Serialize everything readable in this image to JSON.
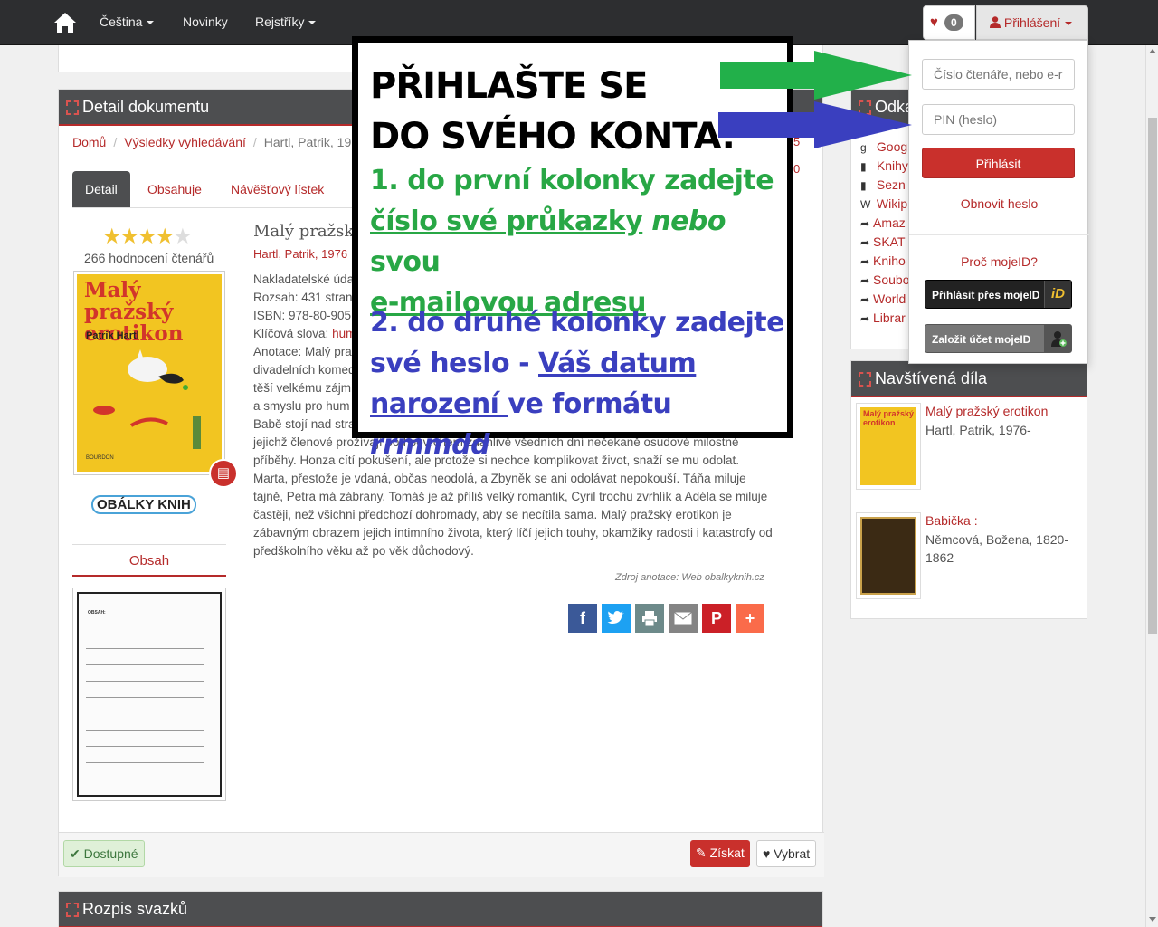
{
  "nav": {
    "language": "Čeština",
    "news": "Novinky",
    "registers": "Rejstříky",
    "favorites_count": "0",
    "login": "Přihlášení"
  },
  "detail_panel": {
    "title": "Detail dokumentu",
    "breadcrumb": [
      "Domů",
      "Výsledky vyhledávání",
      "Hartl, Patrik, 19"
    ],
    "tabs": [
      "Detail",
      "Obsahuje",
      "Návěšťový lístek"
    ],
    "rating": {
      "stars": 4,
      "max": 5,
      "count_text": "266 hodnocení čtenářů"
    },
    "cover": {
      "title": "Malý pražský erotikon",
      "author": "Patrik Hartl",
      "publisher": "BOURDON"
    },
    "obalky_logo": "OBÁLKY KNIH",
    "obsah_tab": "Obsah",
    "doc_title": "Malý pražský",
    "doc_author": "Hartl, Patrik, 1976",
    "lines": [
      "Nakladatelské úda",
      "Rozsah: 431 stran",
      "ISBN: 978-80-905",
      "Anotace: Malý pra",
      "divadelních komed",
      "těší velkému zájm",
      "a smyslu pro hum",
      "Babě stojí nad stra"
    ],
    "keywords_label": "Klíčová slova:",
    "keywords_value": "hum",
    "annotation_rest": "jejichž členové prožívají pod povrchem zdánlivě všedních dní nečekaně osudové milostné příběhy. Honza cítí pokušení, ale protože si nechce komplikovat život, snaží se mu odolat. Marta, přestože je vdaná, občas neodolá, a Zbyněk se ani odolávat nepokouší. Táňa miluje tajně, Petra má zábrany, Tomáš je až příliš velký romantik, Cyril trochu zvrhlík a Adéla se miluje častěji, než všichni předchozí dohromady, aby se necítila sama. Malý pražský erotikon je zábavným obrazem jejich intimního života, který líčí jejich touhy, okamžiky radosti i katastrofy od předškolního věku až po věk důchodový.",
    "source": "Zdroj anotace: Web obalkyknih.cz",
    "available": "Dostupné",
    "get": "Získat",
    "select": "Vybrat",
    "cut_digits": [
      "5",
      "0"
    ]
  },
  "volumes_panel": {
    "title": "Rozpis svazků"
  },
  "links_panel": {
    "title": "Odka",
    "items": [
      "Goog",
      "Knihy",
      "Sezn",
      "Wikip",
      "Amaz",
      "SKAT",
      "Kniho",
      "Soubo",
      "World",
      "Librar"
    ]
  },
  "visited_panel": {
    "title": "Navštívená díla",
    "items": [
      {
        "title": "Malý pražský erotikon",
        "author": "Hartl, Patrik, 1976-"
      },
      {
        "title": "Babička :",
        "author": "Němcová, Božena, 1820-1862"
      }
    ]
  },
  "login_dropdown": {
    "reader_placeholder": "Číslo čtenáře, nebo e-r",
    "pin_placeholder": "PIN (heslo)",
    "submit": "Přihlásit",
    "reset": "Obnovit heslo",
    "why_mojeid": "Proč mojeID?",
    "login_mojeid": "Přihlásit přes mojeID",
    "create_mojeid": "Založit účet mojeID"
  },
  "overlay": {
    "head1": "PŘIHLAŠTE SE",
    "head2": "DO SVÉHO KONTA:",
    "step1_a": "1. do první kolonky zadejte",
    "step1_b": "číslo své průkazky",
    "step1_c": "nebo",
    "step1_d": "svou",
    "step1_e": "e-mailovou adresu",
    "step2_a": "2. do druhé kolonky zadejte",
    "step2_b": "své heslo - ",
    "step2_c": "Váš datum",
    "step2_d": "narození ",
    "step2_e": "ve formátu ",
    "step2_f": "rrmmdd",
    "colors": {
      "green": "#28a745",
      "blue": "#3a3fbf"
    }
  },
  "colors": {
    "accent": "#b52a2a",
    "navbar": "#2d2e30",
    "panel_head": "#4d4e50"
  }
}
